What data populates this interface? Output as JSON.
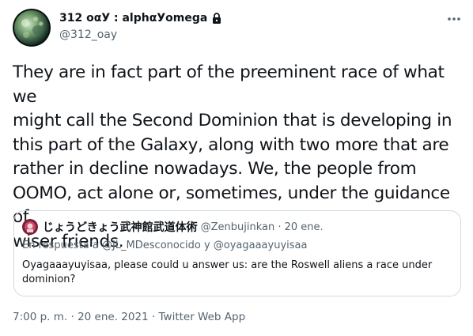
{
  "author": {
    "display_name": "312 οαУ : alphαУomega",
    "handle": "@312_oay"
  },
  "tweet": {
    "text": "They are in fact part of the preeminent race of what we\nmight call the Second Dominion that is developing in\nthis part of the Galaxy, along with two more that are\nrather in decline nowadays. We, the people from\nOOMO, act alone or, sometimes, under the guidance of\nwiser friends.",
    "timestamp": "7:00 p. m. · 20 ene. 2021 · Twitter Web App"
  },
  "quote": {
    "display_name": "じょうどきょう武神館武道体術",
    "meta": "@Zenbujinkan · 20 ene.",
    "reply_to": "En respuesta a @JL_MDesconocido y @oyagaaayuyisaa",
    "text": "Oyagaaayuyisaa, please could u answer us: are the Roswell aliens a race under dominion?"
  },
  "icons": {
    "protected": "lock-icon",
    "more": "more-icon"
  },
  "colors": {
    "text": "#0f1419",
    "secondary": "#536471",
    "border": "#cfd9de"
  }
}
